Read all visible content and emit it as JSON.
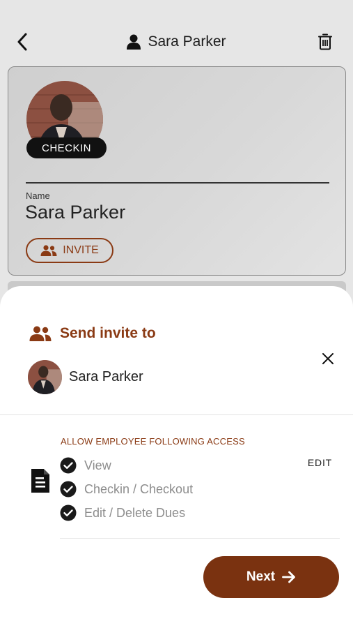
{
  "header": {
    "title": "Sara Parker",
    "back_icon": "chevron-left-icon",
    "user_icon": "person-icon",
    "delete_icon": "trash-icon"
  },
  "profile": {
    "checkin_label": "CHECKIN",
    "name_label": "Name",
    "name_value": "Sara Parker",
    "invite_label": "INVITE"
  },
  "sheet": {
    "title": "Send invite to",
    "recipient_name": "Sara Parker",
    "access_heading": "ALLOW EMPLOYEE FOLLOWING ACCESS",
    "edit_label": "EDIT",
    "permissions": [
      {
        "label": "View",
        "checked": true
      },
      {
        "label": "Checkin / Checkout",
        "checked": true
      },
      {
        "label": "Edit / Delete Dues",
        "checked": true
      }
    ],
    "next_label": "Next"
  },
  "colors": {
    "brand": "#8a3a14",
    "next_button": "#7a3210",
    "checkin_pill": "#111111"
  }
}
